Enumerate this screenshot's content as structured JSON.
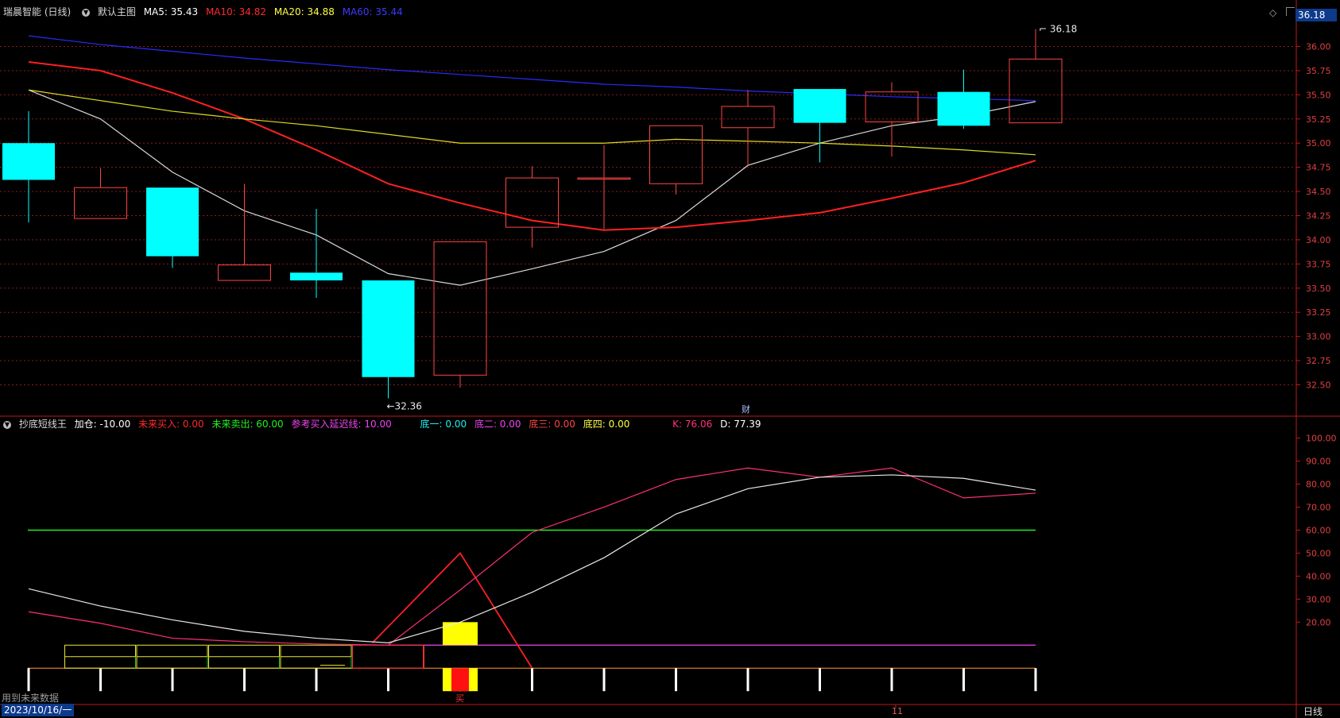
{
  "window": {
    "stock_title": "瑞晨智能 (日线)",
    "main_chart_label": "默认主图"
  },
  "ma_legend": [
    {
      "label": "MA5: 35.43",
      "color": "#ffffff"
    },
    {
      "label": "MA10: 34.82",
      "color": "#ff2a2a"
    },
    {
      "label": "MA20: 34.88",
      "color": "#ffff44"
    },
    {
      "label": "MA60: 35.44",
      "color": "#3a3aff"
    }
  ],
  "indicator": {
    "name": "抄底短线王",
    "legend": [
      {
        "label": "加仓: -10.00",
        "color": "#ffffff"
      },
      {
        "label": "未来买入: 0.00",
        "color": "#ff2a2a"
      },
      {
        "label": "未来卖出: 60.00",
        "color": "#22ee22"
      },
      {
        "label": "参考买入延迟线: 10.00",
        "color": "#ee44ee"
      },
      {
        "label": "底一: 0.00",
        "color": "#22eeee"
      },
      {
        "label": "底二: 0.00",
        "color": "#ee44ee"
      },
      {
        "label": "底三: 0.00",
        "color": "#ff4444"
      },
      {
        "label": "底四: 0.00",
        "color": "#ffff44"
      },
      {
        "label": "K: 76.06",
        "color": "#ff3377"
      },
      {
        "label": "D: 77.39",
        "color": "#ffffff"
      }
    ]
  },
  "price_badge": "36.18",
  "date_badge": "2023/10/16/一",
  "footer_note": "用到未来数据",
  "period_label": "日线",
  "cai_mark": "财",
  "month_marker": "11",
  "signal_char": "买",
  "high_label": "36.18",
  "low_label": "32.36",
  "colors": {
    "up": "#ff4444",
    "down": "#00ffff",
    "grid": "#8b1a1a",
    "axis": "#c01818"
  },
  "chart_data": [
    {
      "type": "candlestick",
      "y_ticks": [
        32.5,
        32.75,
        33.0,
        33.25,
        33.5,
        33.75,
        34.0,
        34.25,
        34.5,
        34.75,
        35.0,
        35.25,
        35.5,
        35.75,
        36.0
      ],
      "ylim": [
        32.2,
        36.3
      ],
      "candles": [
        {
          "open": 35.0,
          "high": 35.33,
          "low": 34.18,
          "close": 34.62
        },
        {
          "open": 34.22,
          "high": 34.74,
          "low": 34.22,
          "close": 34.54
        },
        {
          "open": 34.54,
          "high": 34.54,
          "low": 33.71,
          "close": 33.83
        },
        {
          "open": 33.58,
          "high": 34.58,
          "low": 33.58,
          "close": 33.74
        },
        {
          "open": 33.66,
          "high": 34.32,
          "low": 33.4,
          "close": 33.58
        },
        {
          "open": 33.58,
          "high": 33.58,
          "low": 32.36,
          "close": 32.58
        },
        {
          "open": 32.6,
          "high": 33.98,
          "low": 32.47,
          "close": 33.98
        },
        {
          "open": 34.13,
          "high": 34.76,
          "low": 33.92,
          "close": 34.64
        },
        {
          "open": 34.64,
          "high": 34.98,
          "low": 34.11,
          "close": 34.64
        },
        {
          "open": 34.58,
          "high": 35.18,
          "low": 34.47,
          "close": 35.18
        },
        {
          "open": 35.16,
          "high": 35.55,
          "low": 34.77,
          "close": 35.38
        },
        {
          "open": 35.56,
          "high": 35.56,
          "low": 34.8,
          "close": 35.21
        },
        {
          "open": 35.22,
          "high": 35.63,
          "low": 34.86,
          "close": 35.53
        },
        {
          "open": 35.53,
          "high": 35.76,
          "low": 35.15,
          "close": 35.18
        },
        {
          "open": 35.21,
          "high": 36.18,
          "low": 35.21,
          "close": 35.87
        }
      ],
      "ma": [
        {
          "name": "MA5",
          "color": "#d8d8d8",
          "values": [
            35.55,
            35.25,
            34.7,
            34.3,
            34.05,
            33.65,
            33.53,
            33.7,
            33.88,
            34.2,
            34.77,
            35.0,
            35.18,
            35.28,
            35.43
          ]
        },
        {
          "name": "MA10",
          "color": "#ff2020",
          "values": [
            35.84,
            35.75,
            35.52,
            35.25,
            34.93,
            34.58,
            34.38,
            34.2,
            34.1,
            34.13,
            34.2,
            34.28,
            34.43,
            34.59,
            34.82
          ]
        },
        {
          "name": "MA20",
          "color": "#dddd22",
          "values": [
            35.55,
            35.44,
            35.33,
            35.25,
            35.18,
            35.09,
            35.0,
            35.0,
            35.0,
            35.04,
            35.02,
            35.0,
            34.97,
            34.93,
            34.88
          ]
        },
        {
          "name": "MA60",
          "color": "#2a2aff",
          "values": [
            36.11,
            36.02,
            35.95,
            35.88,
            35.82,
            35.76,
            35.71,
            35.66,
            35.61,
            35.58,
            35.54,
            35.51,
            35.48,
            35.46,
            35.44
          ]
        }
      ]
    },
    {
      "type": "line",
      "y_ticks": [
        20,
        30,
        40,
        50,
        60,
        70,
        80,
        90,
        100
      ],
      "ylim": [
        -12,
        104
      ],
      "series": [
        {
          "name": "K",
          "color": "#ff2f7a",
          "values": [
            24.5,
            19.5,
            13.0,
            11.5,
            10.5,
            10.0,
            34.0,
            59.0,
            70.0,
            82.0,
            87.0,
            83.0,
            87.0,
            74.0,
            76.06
          ]
        },
        {
          "name": "D",
          "color": "#e8e8e8",
          "values": [
            34.5,
            27.0,
            21.0,
            16.0,
            13.0,
            11.0,
            20.0,
            33.0,
            48.0,
            67.0,
            78.0,
            83.0,
            84.0,
            82.5,
            77.39
          ]
        }
      ],
      "sell_line": 60.0,
      "buy_delay_line": 10.0,
      "add_position": -10.0,
      "future_buy": [
        0,
        0,
        0,
        0,
        0,
        0,
        50,
        0,
        0,
        0,
        0,
        0,
        0,
        0,
        0
      ]
    }
  ]
}
